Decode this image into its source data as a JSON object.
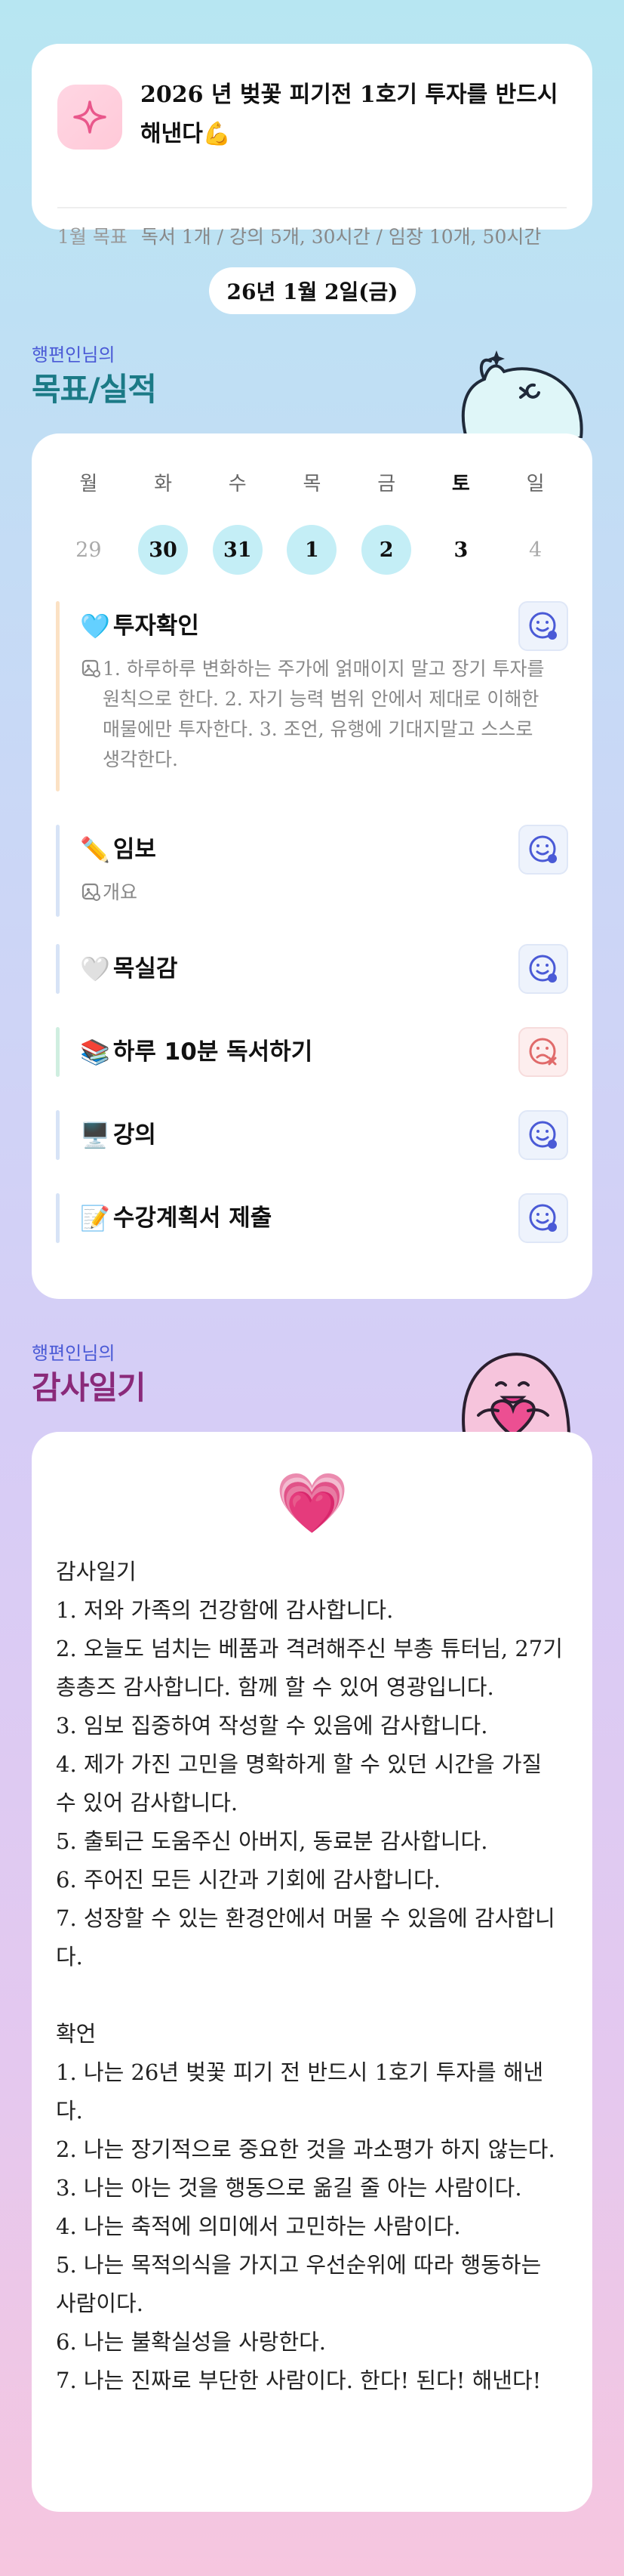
{
  "goal": {
    "title": "2026 년 벚꽃 피기전 1호기 투자를 반드시 해낸다💪",
    "month_label": "1월 목표",
    "month_goals": "독서 1개 / 강의 5개, 30시간 / 임장 10개, 50시간"
  },
  "date_label": "26년 1월 2일(금)",
  "goals_section": {
    "owner": "행편인님의",
    "title": "목표/실적"
  },
  "week": {
    "days": [
      "월",
      "화",
      "수",
      "목",
      "금",
      "토",
      "일"
    ],
    "dates": [
      "29",
      "30",
      "31",
      "1",
      "2",
      "3",
      "4"
    ]
  },
  "tasks": [
    {
      "emoji": "🩵",
      "name": "투자확인",
      "note": "1. 하루하루 변화하는 주가에 얽매이지 말고 장기 투자를 원칙으로 한다. 2. 자기 능력 범위 안에서 제대로 이해한 매물에만 투자한다. 3. 조언, 유행에 기대지말고 스스로 생각한다.",
      "status": "done"
    },
    {
      "emoji": "✏️",
      "name": "임보",
      "note": "개요",
      "status": "done"
    },
    {
      "emoji": "🤍",
      "name": "목실감",
      "note": "",
      "status": "done"
    },
    {
      "emoji": "📚",
      "name": " 하루 10분 독서하기",
      "note": "",
      "status": "fail"
    },
    {
      "emoji": "🖥️",
      "name": "강의",
      "note": "",
      "status": "done"
    },
    {
      "emoji": "📝",
      "name": "수강계획서 제출",
      "note": "",
      "status": "done"
    }
  ],
  "gratitude_section": {
    "owner": "행편인님의",
    "title": "감사일기"
  },
  "gratitude": {
    "icon": "💗",
    "text": "감사일기\n1. 저와 가족의 건강함에 감사합니다.\n2. 오늘도 넘치는 베품과 격려해주신 부총 튜터님, 27기 총총즈 감사합니다. 함께 할 수 있어 영광입니다.\n3. 임보 집중하여 작성할 수 있음에 감사합니다.\n4. 제가 가진 고민을 명확하게 할 수 있던 시간을 가질 수 있어 감사합니다.\n5. 출퇴근 도움주신 아버지, 동료분 감사합니다.\n6. 주어진 모든 시간과 기회에 감사합니다.\n7. 성장할 수 있는 환경안에서 머물 수 있음에 감사합니다.\n\n확언\n1. 나는 26년 벚꽃 피기 전 반드시 1호기 투자를 해낸다.\n2. 나는 장기적으로 중요한 것을 과소평가 하지 않는다.\n3. 나는 아는 것을 행동으로 옮길 줄 아는 사람이다.\n4. 나는 축적에 의미에서 고민하는 사람이다.\n5. 나는 목적의식을 가지고 우선순위에 따라 행동하는 사람이다.\n6. 나는 불확실성을 사랑한다.\n7. 나는 진짜로 부단한 사람이다. 한다! 된다! 해낸다!"
  },
  "colors": {
    "accent_blue": "#4a5ad6",
    "highlight": "#c4eef6",
    "title_teal": "#1b7a86",
    "title_purple": "#8a2a7a",
    "heart": "#e83a8c"
  }
}
